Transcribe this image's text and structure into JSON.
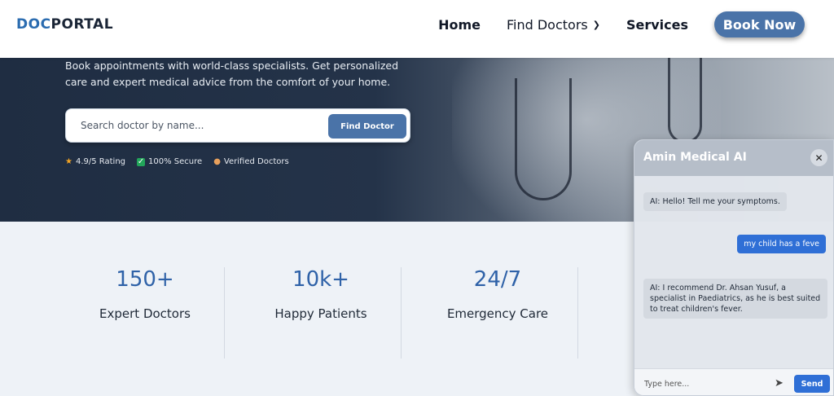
{
  "header": {
    "logo_part1": "DOC",
    "logo_part2": "PORTAL",
    "nav": {
      "home": "Home",
      "find_doctors": "Find Doctors",
      "services": "Services",
      "book_now": "Book Now"
    }
  },
  "hero": {
    "description": "Book appointments with world-class specialists. Get personalized care and expert medical advice from the comfort of your home.",
    "search": {
      "placeholder": "Search doctor by name...",
      "button": "Find Doctor"
    },
    "badges": [
      {
        "icon": "star-icon",
        "label": "4.9/5 Rating"
      },
      {
        "icon": "check-icon",
        "label": "100% Secure"
      },
      {
        "icon": "doctor-icon",
        "label": "Verified Doctors"
      }
    ]
  },
  "stats": [
    {
      "value": "150+",
      "label": "Expert Doctors"
    },
    {
      "value": "10k+",
      "label": "Happy Patients"
    },
    {
      "value": "24/7",
      "label": "Emergency Care"
    }
  ],
  "chat": {
    "title": "Amin Medical AI",
    "messages": [
      {
        "from": "ai",
        "text": "AI: Hello! Tell me your symptoms."
      },
      {
        "from": "user",
        "text": "my child has a feve"
      },
      {
        "from": "ai",
        "text": "AI: I recommend Dr. Ahsan Yusuf, a specialist in Paediatrics, as he is best suited to treat children's fever."
      }
    ],
    "input_placeholder": "Type here...",
    "send_label": "Send"
  },
  "colors": {
    "brand_blue": "#2b6cb0",
    "button_blue": "#4a73a8",
    "stat_blue": "#2f62a8",
    "chat_blue": "#2f6fd6"
  }
}
